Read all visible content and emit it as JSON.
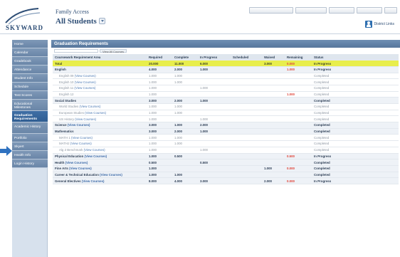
{
  "header": {
    "title": "Family Access",
    "subtitle": "All Students",
    "top_links": [
      "",
      "",
      "",
      "",
      ""
    ],
    "district_link": "District Links"
  },
  "sidebar": {
    "items": [
      {
        "label": "Home"
      },
      {
        "label": "Calendar"
      },
      {
        "label": "Gradebook"
      },
      {
        "label": "Attendance"
      },
      {
        "label": "Student Info"
      },
      {
        "label": "Schedule"
      },
      {
        "label": "Test Scores"
      },
      {
        "label": "Educational Milestones"
      },
      {
        "label": "Graduation Requirements",
        "active": true
      },
      {
        "label": "Academic History"
      },
      {
        "label": "Portfolio"
      },
      {
        "label": "Skyert"
      },
      {
        "label": "Health Info"
      },
      {
        "label": "Login History"
      }
    ]
  },
  "main": {
    "panel_title": "Graduation Requirements",
    "tabs": [
      "",
      "View All Courses"
    ],
    "columns": [
      "Coursework Requirement Area",
      "Required",
      "Complete",
      "In Progress",
      "Scheduled",
      "Waived",
      "Remaining",
      "Status"
    ],
    "rows": [
      {
        "type": "total",
        "label": "Total",
        "link": "",
        "required": "20.000",
        "complete": "11.000",
        "inprogress": "6.000",
        "scheduled": "",
        "waived": "3.000",
        "remaining": "0.000",
        "remaining_red": true,
        "status": "In Progress"
      },
      {
        "type": "category",
        "label": "English",
        "link": "",
        "required": "4.000",
        "complete": "2.000",
        "inprogress": "1.000",
        "scheduled": "",
        "waived": "",
        "remaining": "1.000",
        "remaining_red": true,
        "status": "In Progress"
      },
      {
        "type": "course",
        "label": "English 09",
        "link": "(View Courses)",
        "required": "1.000",
        "complete": "1.000",
        "inprogress": "",
        "scheduled": "",
        "waived": "",
        "remaining": "",
        "remaining_red": false,
        "status": "Completed"
      },
      {
        "type": "course",
        "label": "English 10",
        "link": "(View Courses)",
        "required": "1.000",
        "complete": "1.000",
        "inprogress": "",
        "scheduled": "",
        "waived": "",
        "remaining": "",
        "remaining_red": false,
        "status": "Completed"
      },
      {
        "type": "course",
        "label": "English 11",
        "link": "(View Courses)",
        "required": "1.000",
        "complete": "",
        "inprogress": "1.000",
        "scheduled": "",
        "waived": "",
        "remaining": "",
        "remaining_red": false,
        "status": "Completed"
      },
      {
        "type": "course",
        "label": "English 12",
        "link": "",
        "required": "1.000",
        "complete": "",
        "inprogress": "",
        "scheduled": "",
        "waived": "",
        "remaining": "1.000",
        "remaining_red": true,
        "status": "Completed"
      },
      {
        "type": "category",
        "label": "Social Studies",
        "link": "",
        "required": "3.000",
        "complete": "2.000",
        "inprogress": "1.000",
        "scheduled": "",
        "waived": "",
        "remaining": "",
        "remaining_red": false,
        "status": "Completed"
      },
      {
        "type": "course",
        "label": "World Studies",
        "link": "(View Courses)",
        "required": "1.000",
        "complete": "1.000",
        "inprogress": "",
        "scheduled": "",
        "waived": "",
        "remaining": "",
        "remaining_red": false,
        "status": "Completed"
      },
      {
        "type": "course",
        "label": "European Studies",
        "link": "(View Courses)",
        "required": "1.000",
        "complete": "1.000",
        "inprogress": "",
        "scheduled": "",
        "waived": "",
        "remaining": "",
        "remaining_red": false,
        "status": "Completed"
      },
      {
        "type": "course",
        "label": "US History",
        "link": "(View Courses)",
        "required": "1.000",
        "complete": "",
        "inprogress": "1.000",
        "scheduled": "",
        "waived": "",
        "remaining": "",
        "remaining_red": false,
        "status": "Completed"
      },
      {
        "type": "category",
        "label": "Science",
        "link": "(View Courses)",
        "required": "3.000",
        "complete": "1.000",
        "inprogress": "2.000",
        "scheduled": "",
        "waived": "",
        "remaining": "",
        "remaining_red": false,
        "status": "Completed"
      },
      {
        "type": "category",
        "label": "Mathematics",
        "link": "",
        "required": "3.000",
        "complete": "2.000",
        "inprogress": "1.000",
        "scheduled": "",
        "waived": "",
        "remaining": "",
        "remaining_red": false,
        "status": "Completed"
      },
      {
        "type": "course",
        "label": "MATH 1",
        "link": "(View Courses)",
        "required": "1.000",
        "complete": "1.000",
        "inprogress": "",
        "scheduled": "",
        "waived": "",
        "remaining": "",
        "remaining_red": false,
        "status": "Completed"
      },
      {
        "type": "course",
        "label": "MATH2",
        "link": "(View Courses)",
        "required": "1.000",
        "complete": "1.000",
        "inprogress": "",
        "scheduled": "",
        "waived": "",
        "remaining": "",
        "remaining_red": false,
        "status": "Completed"
      },
      {
        "type": "course",
        "label": "Alg 2 Benchmark",
        "link": "(View Courses)",
        "required": "1.000",
        "complete": "",
        "inprogress": "1.000",
        "scheduled": "",
        "waived": "",
        "remaining": "",
        "remaining_red": false,
        "status": "Completed"
      },
      {
        "type": "category",
        "label": "Physical Education",
        "link": "(View Courses)",
        "required": "1.000",
        "complete": "0.500",
        "inprogress": "",
        "scheduled": "",
        "waived": "",
        "remaining": "0.500",
        "remaining_red": true,
        "status": "In Progress"
      },
      {
        "type": "category",
        "label": "Health",
        "link": "(View Courses)",
        "required": "0.500",
        "complete": "",
        "inprogress": "0.500",
        "scheduled": "",
        "waived": "",
        "remaining": "",
        "remaining_red": false,
        "status": "Completed"
      },
      {
        "type": "category",
        "label": "Fine Arts",
        "link": "(View Courses)",
        "required": "1.000",
        "complete": "",
        "inprogress": "",
        "scheduled": "",
        "waived": "1.000",
        "remaining": "0.000",
        "remaining_red": true,
        "status": "Completed"
      },
      {
        "type": "category",
        "label": "Career & Technical Education",
        "link": "(View Courses)",
        "required": "1.000",
        "complete": "1.000",
        "inprogress": "",
        "scheduled": "",
        "waived": "",
        "remaining": "",
        "remaining_red": false,
        "status": "Completed"
      },
      {
        "type": "category",
        "label": "General Electives",
        "link": "(View Courses)",
        "required": "8.000",
        "complete": "4.000",
        "inprogress": "3.000",
        "scheduled": "",
        "waived": "2.000",
        "remaining": "0.000",
        "remaining_red": true,
        "status": "In Progress"
      }
    ]
  },
  "colors": {
    "header_blue": "#2d4d75",
    "nav_bg": "#7e98b7",
    "nav_active": "#2f5d92",
    "total_highlight": "#e8ee4c",
    "remaining_red": "#e0463a",
    "arrow_blue": "#2f72c0"
  }
}
